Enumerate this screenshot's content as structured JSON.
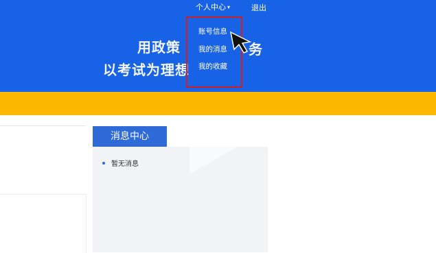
{
  "header": {
    "banner_title_fragment": "",
    "slogan_line1": "用政策",
    "slogan_line1_tail": "务",
    "slogan_line2": "以考试为理想"
  },
  "topnav": {
    "user_center_label": "个人中心",
    "logout_label": "退出"
  },
  "dropdown": {
    "items": [
      {
        "label": "账号信息"
      },
      {
        "label": "我的消息"
      },
      {
        "label": "我的收藏"
      }
    ]
  },
  "message_center": {
    "tab_label": "消息中心",
    "items": [
      {
        "text": "暂无消息"
      }
    ]
  },
  "colors": {
    "banner_blue": "#1862e6",
    "accent_yellow": "#fcb801",
    "highlight_red": "#d41d1d",
    "tab_blue": "#2f6bd8"
  }
}
